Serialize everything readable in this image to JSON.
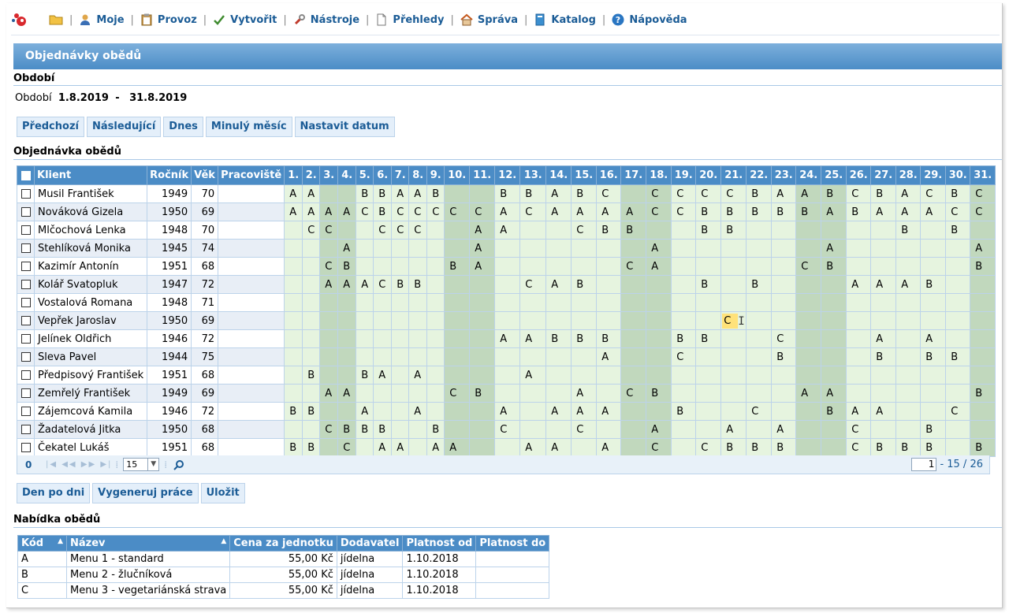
{
  "menu": {
    "items": [
      {
        "label": "Moje",
        "icon": "user-icon"
      },
      {
        "label": "Provoz",
        "icon": "clipboard-icon"
      },
      {
        "label": "Vytvořit",
        "icon": "checkmark-icon"
      },
      {
        "label": "Nástroje",
        "icon": "wrench-icon"
      },
      {
        "label": "Přehledy",
        "icon": "document-icon"
      },
      {
        "label": "Správa",
        "icon": "home-icon"
      },
      {
        "label": "Katalog",
        "icon": "book-icon"
      },
      {
        "label": "Nápověda",
        "icon": "help-icon"
      }
    ]
  },
  "page": {
    "title": "Objednávky obědů",
    "period_heading": "Období",
    "period_label": "Období",
    "period_from": "1.8.2019",
    "period_dash": "-",
    "period_to": "31.8.2019",
    "order_heading": "Objednávka obědů",
    "offer_heading": "Nabídka obědů"
  },
  "period_buttons": [
    "Předchozí",
    "Následující",
    "Dnes",
    "Minulý měsíc",
    "Nastavit datum"
  ],
  "action_buttons": [
    "Den po dni",
    "Vygeneruj práce",
    "Uložit"
  ],
  "grid": {
    "columns": {
      "client": "Klient",
      "year": "Ročník",
      "age": "Věk",
      "workplace": "Pracoviště"
    },
    "days": [
      "1.",
      "2.",
      "3.",
      "4.",
      "5.",
      "6.",
      "7.",
      "8.",
      "9.",
      "10.",
      "11.",
      "12.",
      "13.",
      "14.",
      "15.",
      "16.",
      "17.",
      "18.",
      "19.",
      "20.",
      "21.",
      "22.",
      "23.",
      "24.",
      "25.",
      "26.",
      "27.",
      "28.",
      "29.",
      "30.",
      "31."
    ],
    "weekend_days": [
      3,
      4,
      10,
      11,
      17,
      18,
      24,
      25,
      31
    ],
    "rows": [
      {
        "name": "Musil František",
        "year": "1949",
        "age": "70",
        "orders": [
          "A",
          "A",
          "",
          "",
          "B",
          "B",
          "A",
          "A",
          "B",
          "",
          "",
          "B",
          "B",
          "A",
          "B",
          "C",
          "",
          "C",
          "C",
          "C",
          "C",
          "B",
          "A",
          "A",
          "B",
          "C",
          "B",
          "A",
          "C",
          "B",
          "C"
        ]
      },
      {
        "name": "Nováková Gizela",
        "year": "1950",
        "age": "69",
        "orders": [
          "A",
          "A",
          "A",
          "A",
          "C",
          "B",
          "C",
          "C",
          "C",
          "C",
          "C",
          "A",
          "C",
          "A",
          "A",
          "A",
          "A",
          "C",
          "C",
          "B",
          "B",
          "B",
          "B",
          "B",
          "A",
          "B",
          "A",
          "A",
          "A",
          "C",
          "C"
        ]
      },
      {
        "name": "Mlčochová Lenka",
        "year": "1948",
        "age": "70",
        "orders": [
          "",
          "C",
          "C",
          "",
          "",
          "C",
          "C",
          "C",
          "",
          "",
          "A",
          "A",
          "",
          "",
          "C",
          "B",
          "B",
          "",
          "",
          "B",
          "B",
          "",
          "",
          "",
          "",
          "",
          "",
          "B",
          "",
          "B",
          ""
        ]
      },
      {
        "name": "Stehlíková Monika",
        "year": "1945",
        "age": "74",
        "orders": [
          "",
          "",
          "",
          "A",
          "",
          "",
          "",
          "",
          "",
          "",
          "A",
          "",
          "",
          "",
          "",
          "",
          "",
          "A",
          "",
          "",
          "",
          "",
          "",
          "",
          "A",
          "",
          "",
          "",
          "",
          "",
          "A"
        ]
      },
      {
        "name": "Kazimír Antonín",
        "year": "1951",
        "age": "68",
        "orders": [
          "",
          "",
          "C",
          "B",
          "",
          "",
          "",
          "",
          "",
          "B",
          "A",
          "",
          "",
          "",
          "",
          "",
          "C",
          "A",
          "",
          "",
          "",
          "",
          "",
          "C",
          "B",
          "",
          "",
          "",
          "",
          "",
          "B"
        ]
      },
      {
        "name": "Kolář Svatopluk",
        "year": "1947",
        "age": "72",
        "orders": [
          "",
          "",
          "A",
          "A",
          "A",
          "C",
          "B",
          "B",
          "",
          "",
          "",
          "",
          "C",
          "A",
          "B",
          "",
          "",
          "",
          "",
          "B",
          "",
          "B",
          "",
          "",
          "",
          "A",
          "A",
          "A",
          "B",
          "",
          ""
        ]
      },
      {
        "name": "Vostalová Romana",
        "year": "1948",
        "age": "71",
        "orders": [
          "",
          "",
          "",
          "",
          "",
          "",
          "",
          "",
          "",
          "",
          "",
          "",
          "",
          "",
          "",
          "",
          "",
          "",
          "",
          "",
          "",
          "",
          "",
          "",
          "",
          "",
          "",
          "",
          "",
          "",
          ""
        ]
      },
      {
        "name": "Vepřek Jaroslav",
        "year": "1950",
        "age": "69",
        "orders": [
          "",
          "",
          "",
          "",
          "",
          "",
          "",
          "",
          "",
          "",
          "",
          "",
          "",
          "",
          "",
          "",
          "",
          "",
          "",
          "",
          "C",
          "",
          "",
          "",
          "",
          "",
          "",
          "",
          "",
          "",
          ""
        ]
      },
      {
        "name": "Jelínek Oldřich",
        "year": "1946",
        "age": "72",
        "orders": [
          "",
          "",
          "",
          "",
          "",
          "",
          "",
          "",
          "",
          "",
          "",
          "A",
          "A",
          "B",
          "B",
          "B",
          "",
          "",
          "B",
          "B",
          "",
          "",
          "C",
          "",
          "",
          "",
          "A",
          "",
          "A",
          "",
          ""
        ]
      },
      {
        "name": "Sleva Pavel",
        "year": "1944",
        "age": "75",
        "orders": [
          "",
          "",
          "",
          "",
          "",
          "",
          "",
          "",
          "",
          "",
          "",
          "",
          "",
          "",
          "",
          "A",
          "",
          "",
          "C",
          "",
          "",
          "",
          "B",
          "",
          "",
          "",
          "B",
          "",
          "B",
          "B",
          ""
        ]
      },
      {
        "name": "Předpisový František",
        "year": "1951",
        "age": "68",
        "orders": [
          "",
          "B",
          "",
          "",
          "B",
          "A",
          "",
          "A",
          "",
          "",
          "",
          "",
          "A",
          "",
          "",
          "",
          "",
          "",
          "",
          "",
          "",
          "",
          "",
          "",
          "",
          "",
          "",
          "",
          "",
          "",
          ""
        ]
      },
      {
        "name": "Zemřelý František",
        "year": "1949",
        "age": "69",
        "orders": [
          "",
          "",
          "A",
          "A",
          "",
          "",
          "",
          "",
          "",
          "C",
          "B",
          "",
          "",
          "",
          "A",
          "",
          "C",
          "B",
          "",
          "",
          "",
          "",
          "",
          "A",
          "A",
          "",
          "",
          "",
          "",
          "",
          "B"
        ]
      },
      {
        "name": "Zájemcová Kamila",
        "year": "1946",
        "age": "72",
        "orders": [
          "B",
          "B",
          "",
          "",
          "A",
          "",
          "",
          "A",
          "",
          "",
          "",
          "A",
          "",
          "A",
          "A",
          "A",
          "",
          "",
          "B",
          "",
          "",
          "C",
          "",
          "",
          "B",
          "A",
          "A",
          "",
          "",
          "C",
          ""
        ]
      },
      {
        "name": "Žadatelová Jitka",
        "year": "1950",
        "age": "68",
        "orders": [
          "",
          "",
          "C",
          "B",
          "B",
          "B",
          "",
          "",
          "B",
          "",
          "",
          "C",
          "",
          "",
          "C",
          "",
          "",
          "A",
          "",
          "",
          "A",
          "",
          "A",
          "",
          "",
          "C",
          "",
          "",
          "B",
          "",
          ""
        ]
      },
      {
        "name": "Čekatel Lukáš",
        "year": "1951",
        "age": "68",
        "orders": [
          "B",
          "B",
          "",
          "C",
          "",
          "A",
          "A",
          "",
          "A",
          "A",
          "",
          "",
          "A",
          "A",
          "",
          "A",
          "",
          "C",
          "",
          "C",
          "B",
          "B",
          "B",
          "",
          "",
          "C",
          "B",
          "B",
          "B",
          "",
          "B"
        ]
      }
    ],
    "editing_cell": {
      "row": 7,
      "day": 21
    }
  },
  "pager": {
    "selected_count": "0",
    "page_size": "15",
    "page_input": "1",
    "range": "- 15 / 26"
  },
  "offer": {
    "columns": [
      "Kód",
      "Název",
      "Cena za jednotku",
      "Dodavatel",
      "Platnost od",
      "Platnost do"
    ],
    "rows": [
      [
        "A",
        "Menu 1 - standard",
        "55,00 Kč",
        "jídelna",
        "1.10.2018",
        ""
      ],
      [
        "B",
        "Menu 2 - žlučníková",
        "55,00 Kč",
        "jídelna",
        "1.10.2018",
        ""
      ],
      [
        "C",
        "Menu 3 - vegetariánská strava",
        "55,00 Kč",
        "jídelna",
        "1.10.2018",
        ""
      ]
    ]
  },
  "colors": {
    "accent": "#4b8cc6",
    "link": "#1b5c96",
    "day_cell": "#e6f4df",
    "weekend_cell": "#c1d8bd",
    "editing": "#ffe27a"
  }
}
